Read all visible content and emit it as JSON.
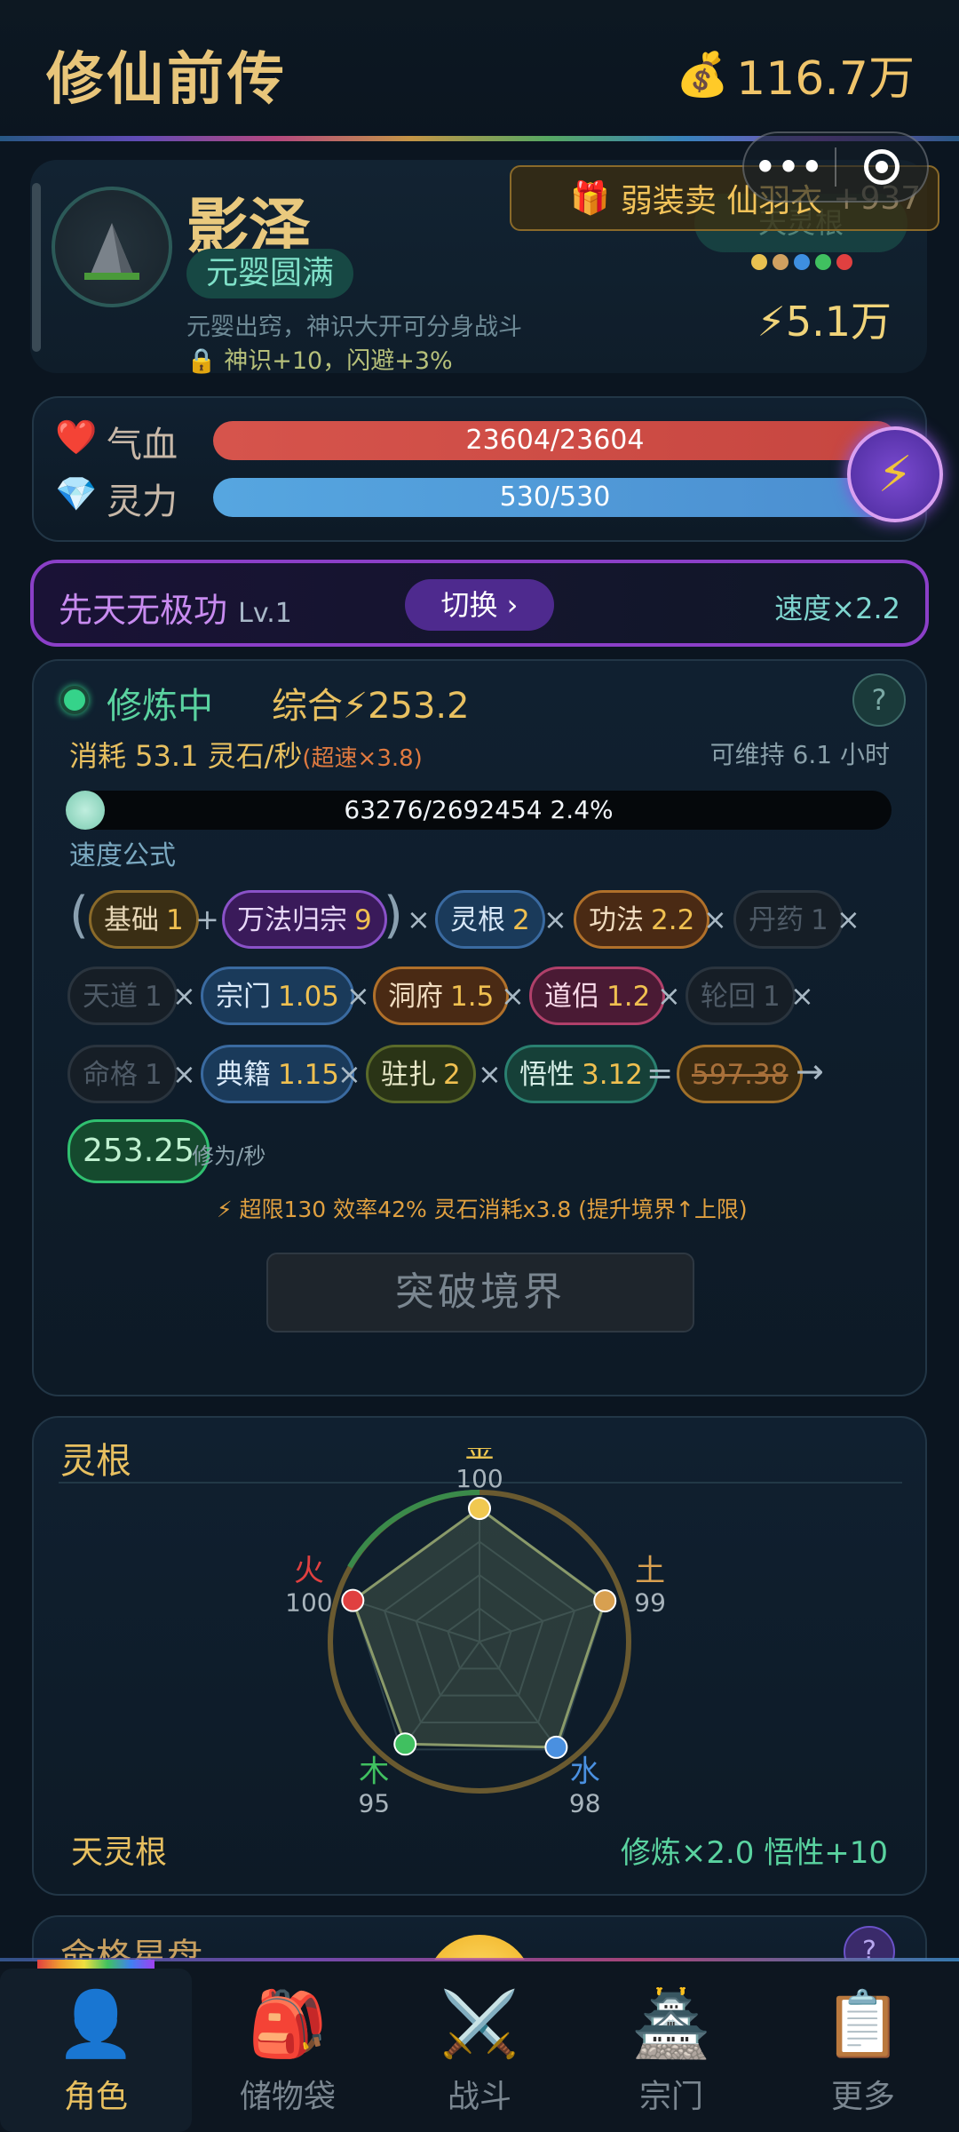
{
  "header": {
    "title": "修仙前传",
    "money": "116.7万"
  },
  "capsule": {
    "more": "•••"
  },
  "character": {
    "name": "影泽",
    "realm": "元婴圆满",
    "realm_desc": "元婴出窍，神识大开可分身战斗",
    "realm_bonus": "神识+10，闪避+3%",
    "gift_text": "弱装卖 仙羽衣",
    "gift_extra": "+937",
    "root_pill": "天灵根",
    "power": "5.1万",
    "element_colors": [
      "#e8c050",
      "#d0a060",
      "#3e8fe0",
      "#40c060",
      "#e04040"
    ]
  },
  "stats": {
    "hp_label": "气血",
    "hp_value": "23604/23604",
    "mp_label": "灵力",
    "mp_value": "530/530"
  },
  "technique": {
    "name": "先天无极功",
    "level": "Lv.1",
    "switch_label": "切换 ›",
    "speed": "速度×2.2"
  },
  "cultivation": {
    "status": "修炼中",
    "total_label": "综合⚡253.2",
    "consume": "消耗 53.1 灵石/秒",
    "consume_fast": "(超速×3.8)",
    "sustain": "可维持 6.1 小时",
    "progress_text": "63276/2692454  2.4%",
    "progress_fraction": 0.024,
    "formula_title": "速度公式",
    "formula": {
      "base_name": "基础",
      "base_val": "1",
      "wanfa_name": "万法归宗",
      "wanfa_val": "9",
      "linggen_name": "灵根",
      "linggen_val": "2",
      "gongfa_name": "功法",
      "gongfa_val": "2.2",
      "danyao_name": "丹药",
      "danyao_val": "1",
      "tiandao_name": "天道",
      "tiandao_val": "1",
      "zongmen_name": "宗门",
      "zongmen_val": "1.05",
      "dongfu_name": "洞府",
      "dongfu_val": "1.5",
      "daolv_name": "道侣",
      "daolv_val": "1.2",
      "lunhui_name": "轮回",
      "lunhui_val": "1",
      "mingge_name": "命格",
      "mingge_val": "1",
      "dianji_name": "典籍",
      "dianji_val": "1.15",
      "zhuzha_name": "驻扎",
      "zhuzha_val": "2",
      "wuxing_name": "悟性",
      "wuxing_val": "3.12",
      "raw_result": "597.38",
      "final_result": "253.25",
      "unit": "修为/秒",
      "open_paren": "(",
      "close_paren": ")",
      "plus": "+",
      "times": "×",
      "equals": "=",
      "arrow": "→"
    },
    "limit_note": "⚡ 超限130 效率42% 灵石消耗x3.8 (提升境界↑上限)",
    "breakthrough_label": "突破境界"
  },
  "spirit_root": {
    "title": "灵根",
    "elements": [
      {
        "name": "金",
        "value": 100,
        "color": "#f0c850"
      },
      {
        "name": "土",
        "value": 99,
        "color": "#d8a050"
      },
      {
        "name": "水",
        "value": 98,
        "color": "#4a90e0"
      },
      {
        "name": "木",
        "value": 95,
        "color": "#40c060"
      },
      {
        "name": "火",
        "value": 100,
        "color": "#e04040"
      }
    ],
    "root_name": "天灵根",
    "bonus": "修炼×2.0   悟性+10"
  },
  "star_disk": {
    "title": "命格星盘",
    "help": "?"
  },
  "nav": [
    {
      "label": "角色",
      "icon": "👤"
    },
    {
      "label": "储物袋",
      "icon": "🎒"
    },
    {
      "label": "战斗",
      "icon": "⚔️"
    },
    {
      "label": "宗门",
      "icon": "🏯"
    },
    {
      "label": "更多",
      "icon": "📋"
    }
  ]
}
